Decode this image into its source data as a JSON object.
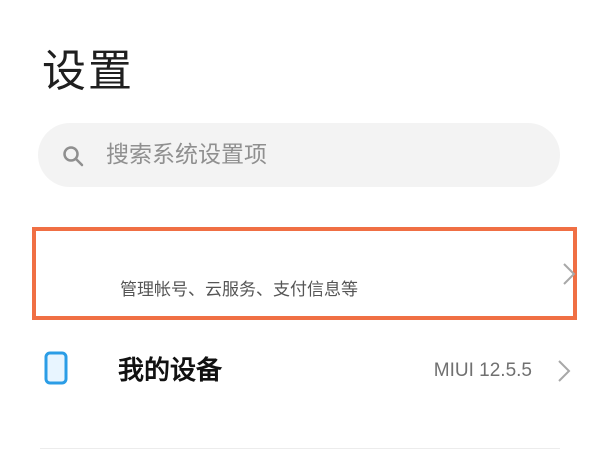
{
  "header": {
    "title": "设置"
  },
  "search": {
    "placeholder": "搜索系统设置项",
    "icon": "search-icon"
  },
  "account": {
    "subtitle": "管理帐号、云服务、支付信息等",
    "chevron_icon": "chevron-right-icon",
    "highlight_color": "#f06f44"
  },
  "device": {
    "icon": "tablet-icon",
    "label": "我的设备",
    "value": "MIUI 12.5.5",
    "chevron_icon": "chevron-right-icon",
    "icon_color": "#2b9de6"
  }
}
